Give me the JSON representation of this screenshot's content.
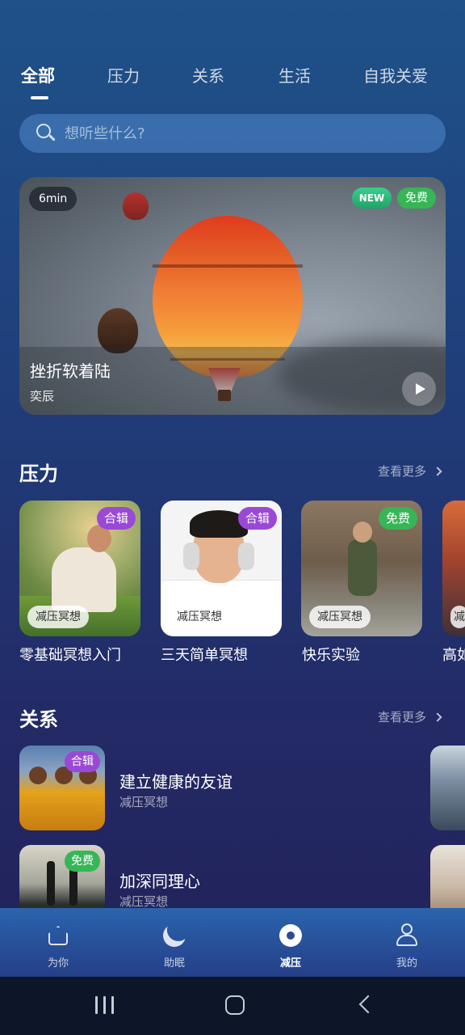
{
  "tabs": [
    "全部",
    "压力",
    "关系",
    "生活",
    "自我关爱"
  ],
  "search": {
    "placeholder": "想听些什么?"
  },
  "hero": {
    "duration": "6min",
    "badge_new": "NEW",
    "badge_free": "免费",
    "title": "挫折软着陆",
    "author": "奕辰"
  },
  "stress_section": {
    "title": "压力",
    "see_more": "查看更多",
    "cards": [
      {
        "title": "零基础冥想入门",
        "tag": "合辑",
        "category": "减压冥想"
      },
      {
        "title": "三天简单冥想",
        "tag": "合辑",
        "category": "减压冥想"
      },
      {
        "title": "快乐实验",
        "tag": "免费",
        "category": "减压冥想"
      },
      {
        "title": "高如",
        "tag": "",
        "category": "减"
      }
    ]
  },
  "relation_section": {
    "title": "关系",
    "see_more": "查看更多",
    "items": [
      {
        "title": "建立健康的友谊",
        "tag": "合辑",
        "category": "减压冥想"
      },
      {
        "title": "加深同理心",
        "tag": "免费",
        "category": "减压冥想"
      }
    ]
  },
  "bottom_nav": [
    {
      "label": "为你",
      "icon": "home-icon"
    },
    {
      "label": "助眠",
      "icon": "moon-icon"
    },
    {
      "label": "减压",
      "icon": "meditation-circle-icon"
    },
    {
      "label": "我的",
      "icon": "user-icon"
    }
  ],
  "colors": {
    "accent_purple": "#9a48d6",
    "accent_green": "#36b657",
    "background_top": "#1f5289",
    "background_bottom": "#221f55"
  }
}
